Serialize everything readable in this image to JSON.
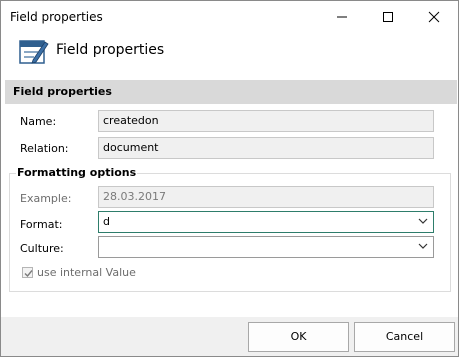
{
  "window": {
    "title": "Field properties"
  },
  "header": {
    "title": "Field properties",
    "icon": "edit-form-icon"
  },
  "section": {
    "title": "Field properties"
  },
  "fields": {
    "name": {
      "label": "Name:",
      "value": "createdon"
    },
    "relation": {
      "label": "Relation:",
      "value": "document"
    }
  },
  "formatting": {
    "title": "Formatting options",
    "example": {
      "label": "Example:",
      "value": "28.03.2017"
    },
    "format": {
      "label": "Format:",
      "value": "d"
    },
    "culture": {
      "label": "Culture:",
      "value": ""
    },
    "use_internal": {
      "label": "use internal Value",
      "checked": true
    }
  },
  "buttons": {
    "ok": "OK",
    "cancel": "Cancel"
  },
  "colors": {
    "accent_focus": "#2e7d6b",
    "section_band": "#d9d9d9",
    "footer": "#f0f0f0"
  }
}
